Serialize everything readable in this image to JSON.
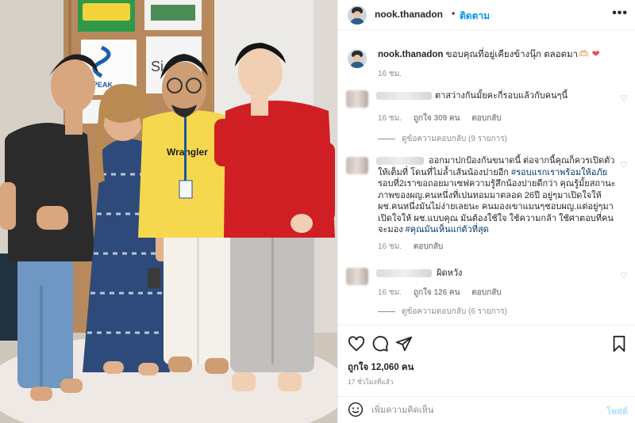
{
  "post": {
    "username": "nook.thanadon",
    "follow_label": "ติดตาม",
    "separator": "•",
    "more_icon": "more-horizontal-icon",
    "photo_logos": [
      "PEAK",
      "Wrangler"
    ]
  },
  "caption": {
    "username": "nook.thanadon",
    "text": "ขอบคุณที่อยู่เคียงข้างนุ๊ก ตลอดมา🫶🏻",
    "heart": "❤",
    "time": "16 ชม."
  },
  "comments": [
    {
      "text": "ตาสว่างกันมั้ยคะกี่รอบแล้วกับคนๆนี้",
      "time": "16 ชม.",
      "likes": "ถูกใจ 309 คน",
      "reply": "ตอบกลับ",
      "view_replies": "ดูข้อความตอบกลับ (9 รายการ)"
    },
    {
      "text_plain": "ออกมาปกป้องกันขนาดนี้ ต่อจากนี้คุณก็ควรเปิดตัวให้เต็มที่ โดนที่ไม่ล้ำเส้นน้องปายอีก ",
      "tag1": "#รอบแรกเราพร้อมให้อภัย",
      "text_plain2": " รอบที่2เราขอถอยมาเซฟความรู้สึกน้องปายดีกว่า คุณรู้มั้ยสถานะภาพของผญ.คนหนึ่งที่เปนทอมมาตลอด 26ปี อยู่ๆมาเปิดใจให้ผช.คนหนึ่งมันไม่ง่ายเลยนะ คนมองเขาแมนๆชอบผญ.แต่อยู่ๆมาเปิดใจให้ ผช.แบบคุณ มันต้องใช้ใจ ใช้ความกล้า ใช้ศาตอบที่คนจะมอง ",
      "tag2": "#คุณมันเห็นแก่ตัวที่สุด",
      "time": "16 ชม.",
      "reply": "ตอบกลับ"
    },
    {
      "text": "ผิดหวัง",
      "time": "16 ชม.",
      "likes": "ถูกใจ 126 คน",
      "reply": "ตอบกลับ",
      "view_replies": "ดูข้อความตอบกลับ (6 รายการ)"
    }
  ],
  "actions": {
    "likes": "ถูกใจ 12,060 คน",
    "ago": "17 ชั่วโมงที่แล้ว"
  },
  "add_comment": {
    "placeholder": "เพิ่มความคิดเห็น",
    "post_label": "โพสต์"
  }
}
